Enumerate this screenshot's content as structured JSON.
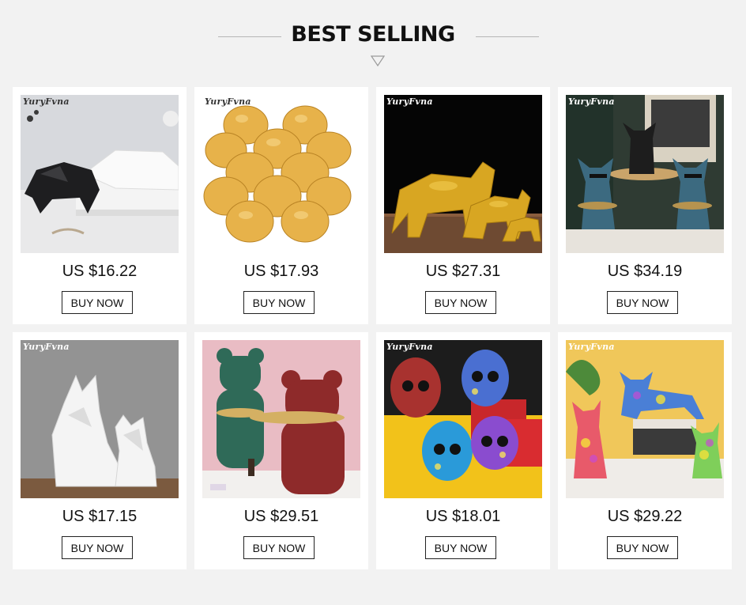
{
  "section": {
    "title": "BEST SELLING"
  },
  "products": [
    {
      "brand": "YuryFvna",
      "image": "geometric-panther-statues",
      "price": "US $16.22",
      "button": "BUY NOW"
    },
    {
      "brand": "YuryFvna",
      "image": "gold-mercury-glass-candle-holders",
      "price": "US $17.93",
      "button": "BUY NOW"
    },
    {
      "brand": "YuryFvna",
      "image": "gold-bull-statues",
      "price": "US $27.31",
      "button": "BUY NOW"
    },
    {
      "brand": "YuryFvna",
      "image": "bulldog-tray-statues",
      "price": "US $34.19",
      "button": "BUY NOW"
    },
    {
      "brand": "YuryFvna",
      "image": "geometric-fox-statues",
      "price": "US $17.15",
      "button": "BUY NOW"
    },
    {
      "brand": "",
      "image": "bear-tray-statues",
      "price": "US $29.51",
      "button": "BUY NOW"
    },
    {
      "brand": "YuryFvna",
      "image": "graffiti-skull-statues",
      "price": "US $18.01",
      "button": "BUY NOW"
    },
    {
      "brand": "YuryFvna",
      "image": "graffiti-dog-statues",
      "price": "US $29.22",
      "button": "BUY NOW"
    }
  ],
  "colors": {
    "background": "#f2f2f2",
    "card": "#ffffff",
    "text": "#111111"
  }
}
